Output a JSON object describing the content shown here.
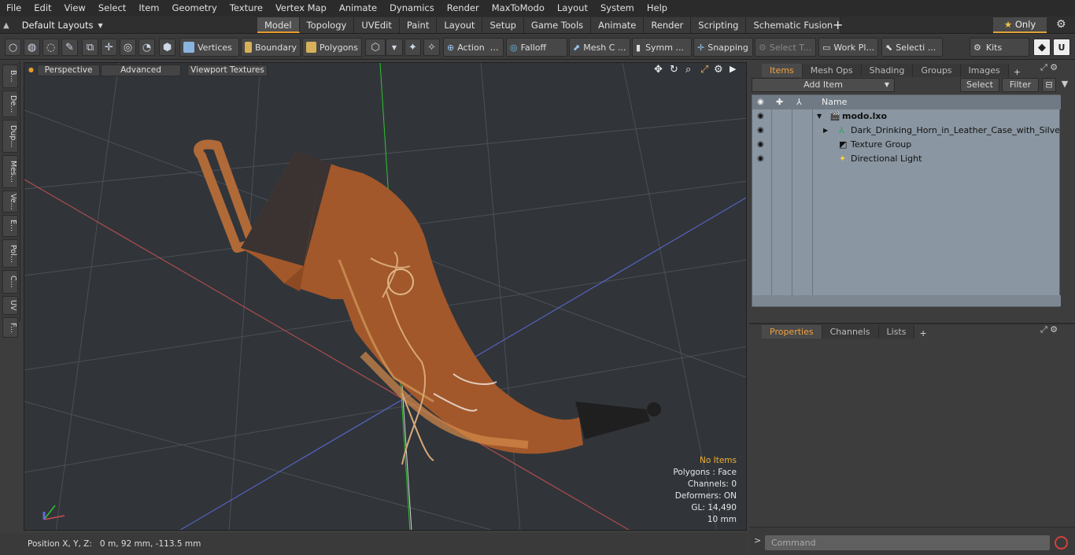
{
  "menu": [
    "File",
    "Edit",
    "View",
    "Select",
    "Item",
    "Geometry",
    "Texture",
    "Vertex Map",
    "Animate",
    "Dynamics",
    "Render",
    "MaxToModo",
    "Layout",
    "System",
    "Help"
  ],
  "layouts_label": "Default Layouts",
  "tabs": [
    "Model",
    "Topology",
    "UVEdit",
    "Paint",
    "Layout",
    "Setup",
    "Game Tools",
    "Animate",
    "Render",
    "Scripting",
    "Schematic Fusion"
  ],
  "only_label": "Only",
  "toolbar": {
    "vertices": "Vertices",
    "boundary": "Boundary",
    "polygons": "Polygons",
    "action": "Action",
    "falloff": "Falloff",
    "mesh_c": "Mesh C ...",
    "symm": "Symm ...",
    "snapping": "Snapping",
    "select_t": "Select T...",
    "work_pl": "Work Pl...",
    "selecti": "Selecti ...",
    "kits": "Kits"
  },
  "left_tabs": [
    "B...",
    "De...",
    "Dup...",
    "Mes...",
    "Ve...",
    "E...",
    "Pol...",
    "C...",
    "UV",
    "F..."
  ],
  "viewport": {
    "perspective": "Perspective",
    "advanced": "Advanced",
    "viewport_textures": "Viewport Textures",
    "stats": {
      "no_items": "No Items",
      "polygons": "Polygons : Face",
      "channels": "Channels: 0",
      "deformers": "Deformers: ON",
      "gl": "GL: 14,490",
      "scale": "10 mm"
    }
  },
  "status": {
    "position": "Position X, Y, Z:   0 m, 92 mm, -113.5 mm"
  },
  "items_panel": {
    "tabs": [
      "Items",
      "Mesh Ops",
      "Shading",
      "Groups",
      "Images"
    ],
    "add_item": "Add Item",
    "select": "Select",
    "filter": "Filter",
    "col_name": "Name",
    "rows": [
      "modo.lxo",
      "Dark_Drinking_Horn_in_Leather_Case_with_Silver_ ...",
      "Texture Group",
      "Directional Light"
    ]
  },
  "props_panel": {
    "tabs": [
      "Properties",
      "Channels",
      "Lists"
    ]
  },
  "command_placeholder": "Command",
  "colors": {
    "accent": "#e89a2c",
    "viewport_bg": "#31353a",
    "list_bg": "#8a96a1"
  }
}
